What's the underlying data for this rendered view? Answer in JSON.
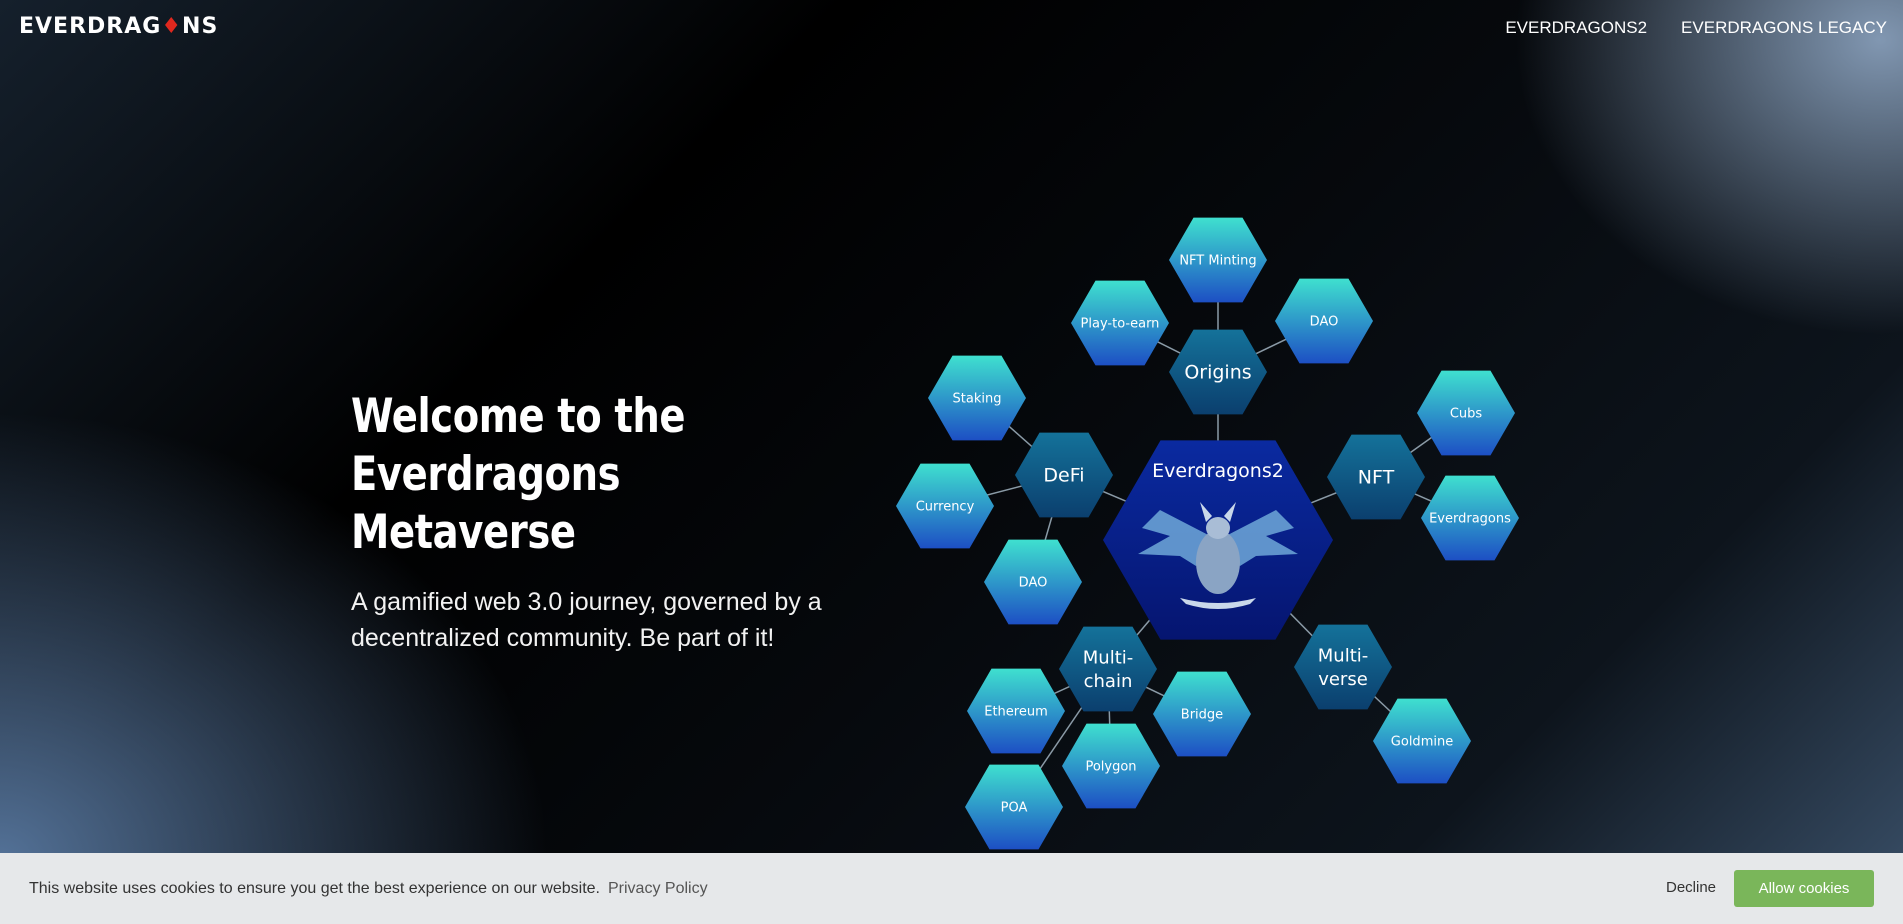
{
  "header": {
    "logo_text_a": "EVERDRAG",
    "logo_text_b": "NS",
    "nav": [
      "EVERDRAGONS2",
      "EVERDRAGONS LEGACY"
    ]
  },
  "hero": {
    "title_line1": "Welcome to the",
    "title_line2": "Everdragons Metaverse",
    "subtitle_line1": "A gamified web 3.0 journey, governed by a",
    "subtitle_line2": "decentralized community. Be part of it!"
  },
  "hexmap": {
    "center_label": "Everdragons2",
    "hubs": [
      {
        "label": [
          "Origins"
        ]
      },
      {
        "label": [
          "DeFi"
        ]
      },
      {
        "label": [
          "NFT"
        ]
      },
      {
        "label": [
          "Multi-",
          "chain"
        ]
      },
      {
        "label": [
          "Multi-",
          "verse"
        ]
      }
    ],
    "leaves": [
      "NFT Minting",
      "Play-to-earn",
      "DAO",
      "Staking",
      "Currency",
      "DAO",
      "Cubs",
      "Everdragons",
      "Ethereum",
      "Bridge",
      "Polygon",
      "POA",
      "Goldmine"
    ]
  },
  "cookie": {
    "message": "This website uses cookies to ensure you get the best experience on our website.",
    "policy_link": "Privacy Policy",
    "decline": "Decline",
    "allow": "Allow cookies"
  },
  "colors": {
    "hex_leaf_top": "#3fe0cf",
    "hex_leaf_bottom": "#1d4fc4",
    "hex_hub": "#0d5a85",
    "hex_center": "#071f8a",
    "cookie_allow": "#7ab65a"
  }
}
